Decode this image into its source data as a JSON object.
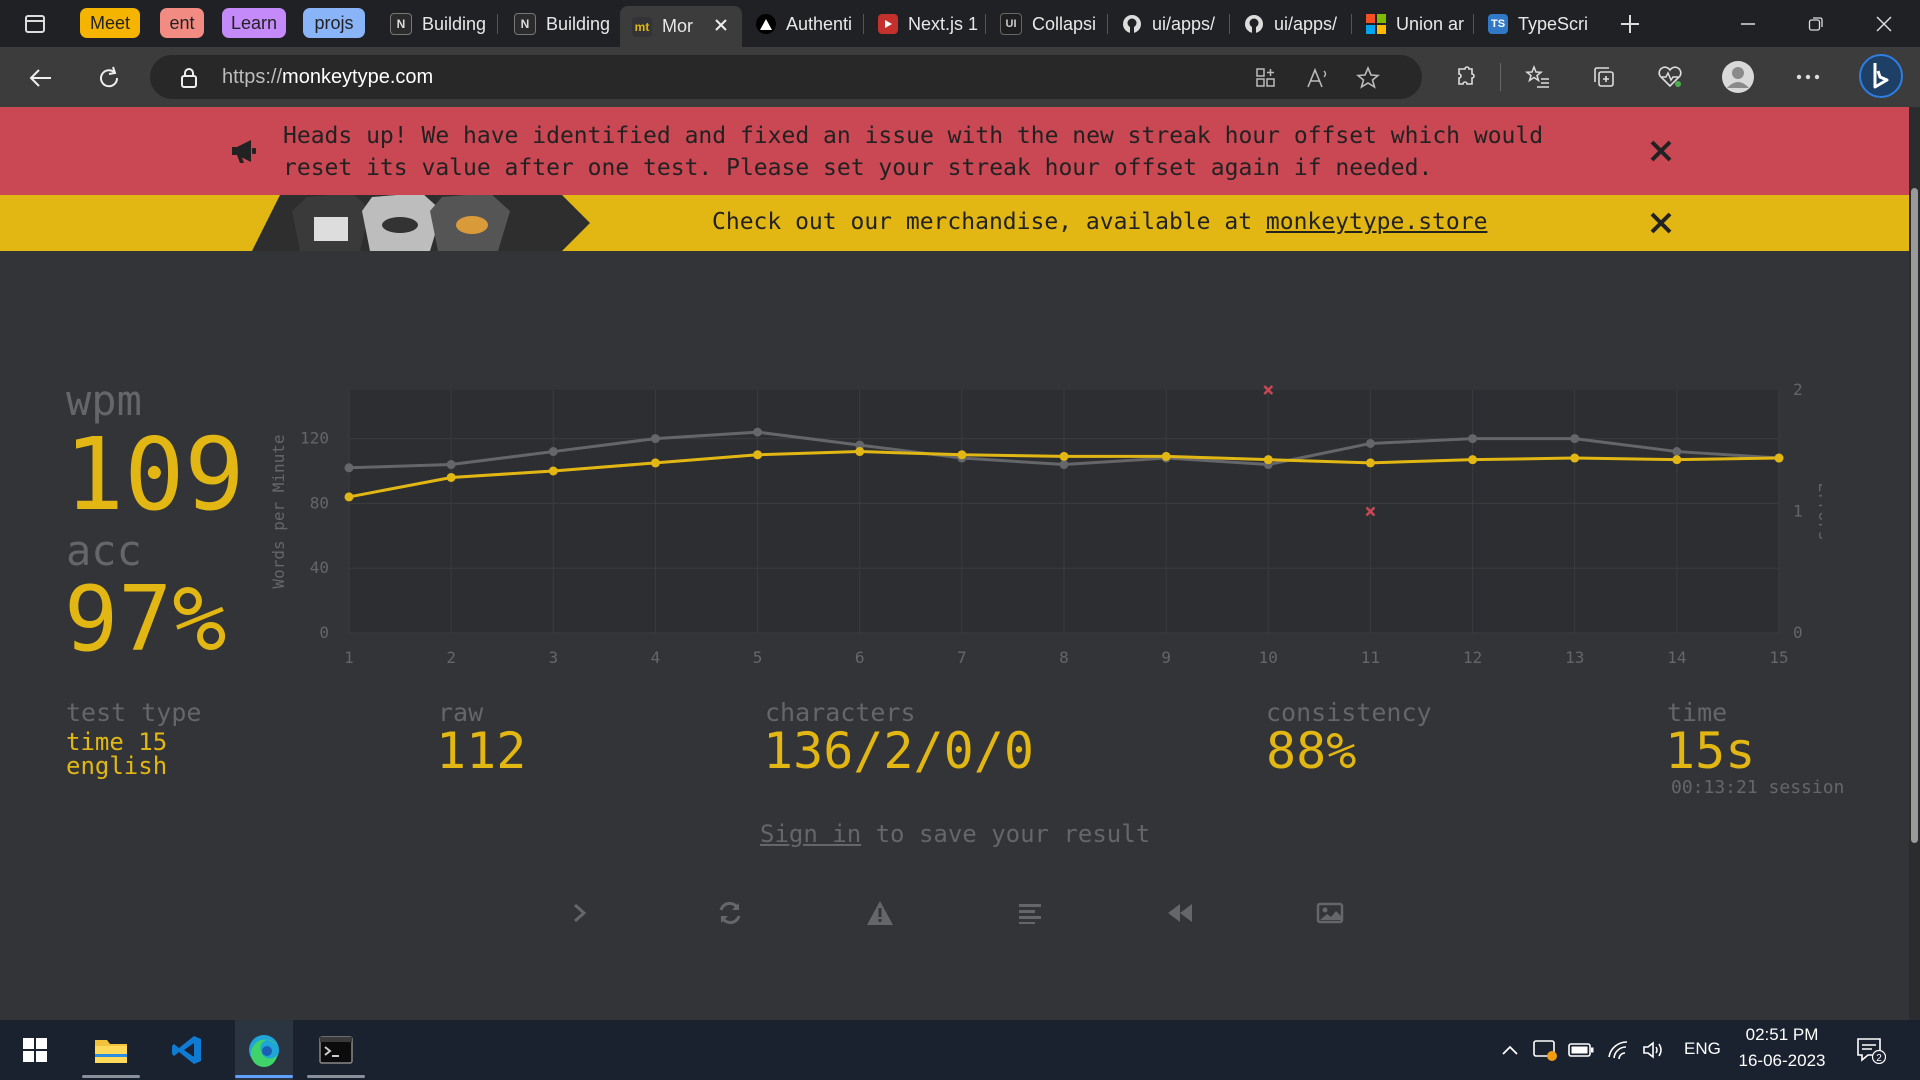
{
  "browser": {
    "tab_groups": [
      {
        "label": "Meet",
        "color": "#f5b400"
      },
      {
        "label": "ent",
        "color": "#f28b82"
      },
      {
        "label": "Learn",
        "color": "#c58af9"
      },
      {
        "label": "projs",
        "color": "#8ab4f8"
      }
    ],
    "tabs": [
      {
        "title": "Building",
        "icon": "notion-icon"
      },
      {
        "title": "Building",
        "icon": "notion-icon"
      },
      {
        "title": "Mor",
        "icon": "monkeytype-icon",
        "fav_text": "mt",
        "active": true
      },
      {
        "title": "Authenti",
        "icon": "vercel-icon"
      },
      {
        "title": "Next.js 1",
        "icon": "youtube-icon"
      },
      {
        "title": "Collapsi",
        "icon": "ui-icon",
        "fav_text": "UI"
      },
      {
        "title": "ui/apps/",
        "icon": "github-icon"
      },
      {
        "title": "ui/apps/",
        "icon": "github-icon"
      },
      {
        "title": "Union ar",
        "icon": "microsoft-icon"
      },
      {
        "title": "TypeScri",
        "icon": "typescript-icon",
        "fav_text": "TS"
      }
    ],
    "url_scheme": "https://",
    "url_host": "monkeytype.com"
  },
  "notices": {
    "alert_text": "Heads up! We have identified and fixed an issue with the new streak hour offset which would reset its value after one test. Please set your streak hour offset again if needed.",
    "merch_prefix": "Check out our merchandise, available at ",
    "merch_link": "monkeytype.store"
  },
  "result": {
    "wpm_label": "wpm",
    "wpm": "109",
    "acc_label": "acc",
    "acc": "97%",
    "test_type_label": "test type",
    "test_type_mode": "time 15",
    "test_type_lang": "english",
    "raw_label": "raw",
    "raw": "112",
    "characters_label": "characters",
    "characters": "136/2/0/0",
    "consistency_label": "consistency",
    "consistency": "88%",
    "time_label": "time",
    "time": "15s",
    "session": "00:13:21 session",
    "sign_in_link": "Sign in",
    "sign_in_suffix": " to save your result"
  },
  "actions": [
    {
      "name": "next-test-button",
      "icon": "chevron-right-icon"
    },
    {
      "name": "restart-test-button",
      "icon": "refresh-icon"
    },
    {
      "name": "report-button",
      "icon": "warning-icon"
    },
    {
      "name": "words-history-button",
      "icon": "align-left-icon"
    },
    {
      "name": "watch-replay-button",
      "icon": "rewind-icon"
    },
    {
      "name": "save-screenshot-button",
      "icon": "image-icon"
    }
  ],
  "chart_data": {
    "type": "line",
    "x": [
      1,
      2,
      3,
      4,
      5,
      6,
      7,
      8,
      9,
      10,
      11,
      12,
      13,
      14,
      15
    ],
    "ylabel": "Words per Minute",
    "y2label": "Errors",
    "ylim": [
      0,
      150
    ],
    "yticks": [
      0,
      40,
      80,
      120
    ],
    "y2lim": [
      0,
      2
    ],
    "y2ticks": [
      0,
      1,
      2
    ],
    "series": [
      {
        "role": "raw",
        "color": "#646669",
        "values": [
          102,
          104,
          112,
          120,
          124,
          116,
          108,
          104,
          108,
          104,
          117,
          120,
          120,
          112,
          108
        ]
      },
      {
        "role": "wpm",
        "color": "#e2b714",
        "values": [
          84,
          96,
          100,
          105,
          110,
          112,
          110,
          109,
          109,
          107,
          105,
          107,
          108,
          107,
          108
        ]
      },
      {
        "role": "errors",
        "color": "#ca4754",
        "points": [
          {
            "x": 10,
            "y": 2
          },
          {
            "x": 11,
            "y": 1
          }
        ]
      }
    ],
    "grid": true
  },
  "system": {
    "language": "ENG",
    "time": "02:51 PM",
    "date": "16-06-2023",
    "notification_count": "2"
  },
  "colors": {
    "bg": "#323437",
    "main": "#e2b714",
    "sub": "#646669",
    "error": "#ca4754"
  }
}
